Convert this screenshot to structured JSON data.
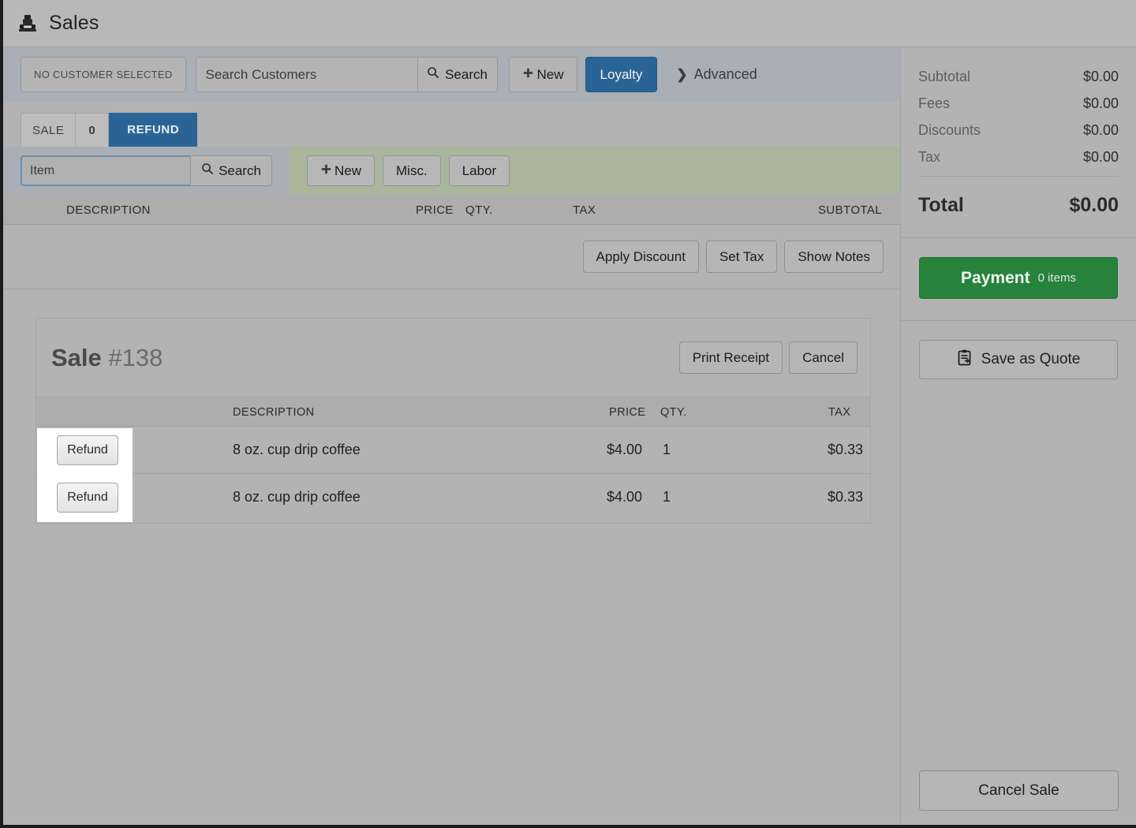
{
  "window": {
    "title": "Sales",
    "icon": "cash-register-icon"
  },
  "customer_bar": {
    "no_customer_label": "NO CUSTOMER SELECTED",
    "search_placeholder": "Search Customers",
    "search_value": "",
    "search_button": "Search",
    "new_button": "New",
    "loyalty_button": "Loyalty",
    "advanced_link": "Advanced"
  },
  "tabs": {
    "sale_label": "SALE",
    "sale_count": "0",
    "refund_label": "REFUND",
    "active": "REFUND"
  },
  "item_bar": {
    "item_placeholder": "Item",
    "item_value": "",
    "search_button": "Search",
    "new_button": "New",
    "misc_button": "Misc.",
    "labor_button": "Labor"
  },
  "main_table": {
    "columns": [
      "DESCRIPTION",
      "PRICE",
      "QTY.",
      "TAX",
      "SUBTOTAL"
    ]
  },
  "action_row": {
    "apply_discount": "Apply Discount",
    "set_tax": "Set Tax",
    "show_notes": "Show Notes"
  },
  "sale_card": {
    "title_prefix": "Sale",
    "title_number": "#138",
    "print_receipt": "Print Receipt",
    "cancel": "Cancel",
    "columns": [
      "DESCRIPTION",
      "PRICE",
      "QTY.",
      "TAX"
    ],
    "rows": [
      {
        "action": "Refund",
        "description": "8 oz. cup drip coffee",
        "price": "$4.00",
        "qty": "1",
        "tax": "$0.33"
      },
      {
        "action": "Refund",
        "description": "8 oz. cup drip coffee",
        "price": "$4.00",
        "qty": "1",
        "tax": "$0.33"
      }
    ]
  },
  "sidebar": {
    "totals": [
      {
        "label": "Subtotal",
        "value": "$0.00"
      },
      {
        "label": "Fees",
        "value": "$0.00"
      },
      {
        "label": "Discounts",
        "value": "$0.00"
      },
      {
        "label": "Tax",
        "value": "$0.00"
      }
    ],
    "total_label": "Total",
    "total_value": "$0.00",
    "payment_label": "Payment",
    "payment_items": "0 items",
    "save_quote_label": "Save as Quote",
    "cancel_sale_label": "Cancel Sale"
  },
  "colors": {
    "accent_blue": "#2a6496",
    "payment_green": "#27823c",
    "green_strip": "#a9b69c",
    "bar_blue_gray": "#a9afb4",
    "page_bg": "#b3b3b3"
  }
}
